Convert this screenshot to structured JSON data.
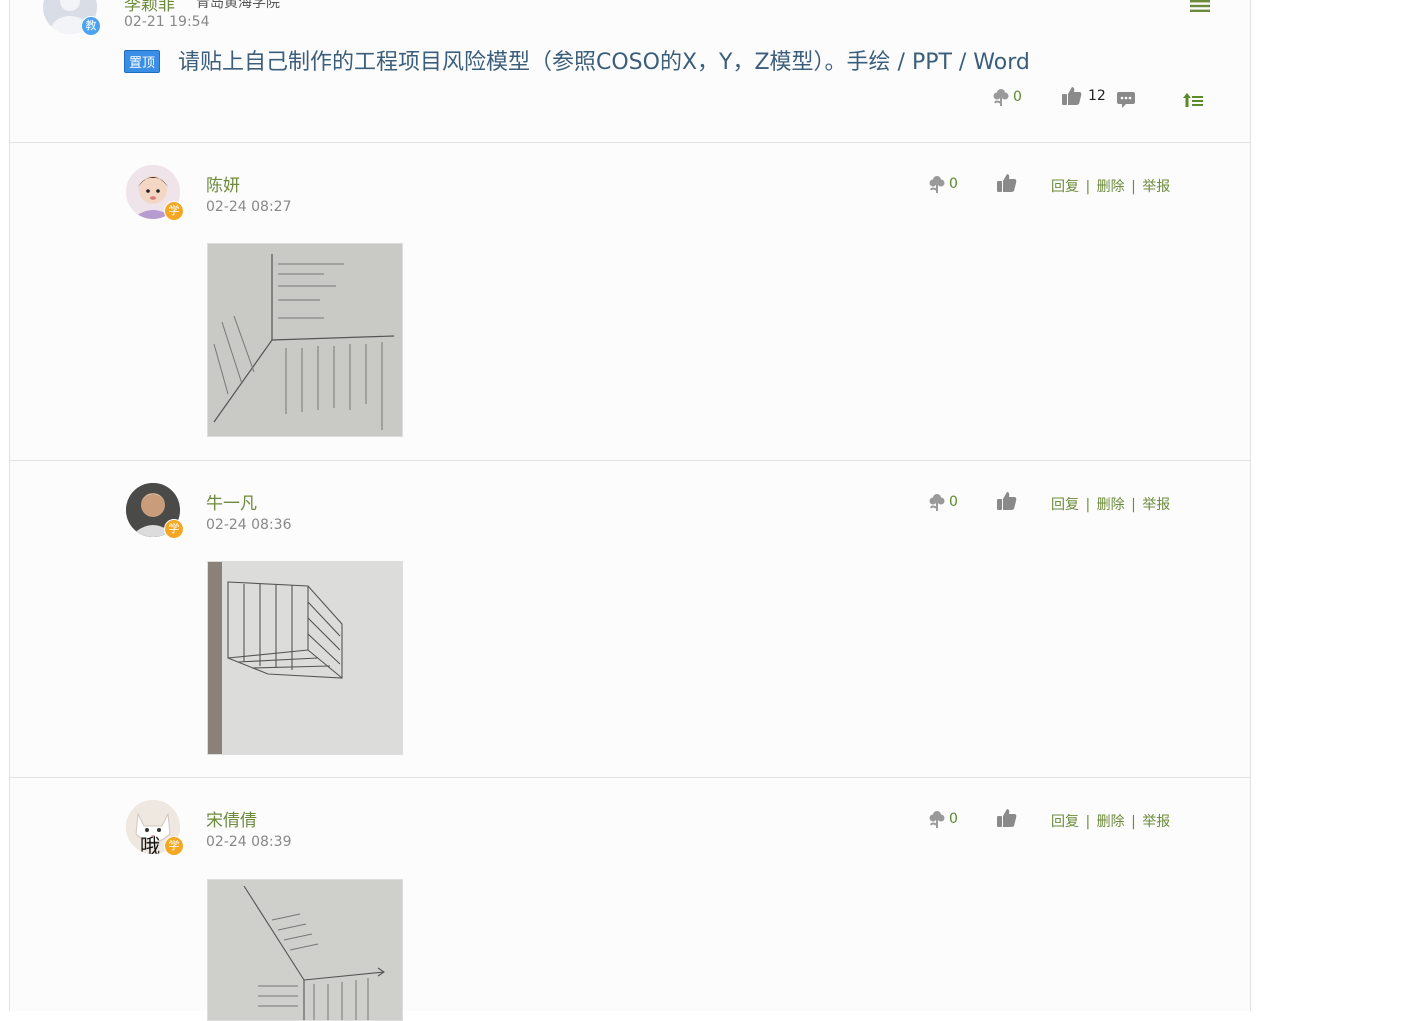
{
  "topic": {
    "author_name": "李颖菲",
    "school": "青岛黄海学院",
    "role_badge": "教",
    "time": "02-21 19:54",
    "pin_label": "置顶",
    "title": "请贴上自己制作的工程项目风险模型（参照COSO的X，Y，Z模型）。手绘 / PPT / Word",
    "flower_count": "0",
    "like_count": "12",
    "menu_icon": "menu-lines-icon"
  },
  "replies": [
    {
      "name": "陈妍",
      "time": "02-24 08:27",
      "role_badge": "学",
      "avatar_overlay": "",
      "flower_count": "0",
      "actions": {
        "reply": "回复",
        "delete": "删除",
        "report": "举报",
        "sep": "|"
      }
    },
    {
      "name": "牛一凡",
      "time": "02-24 08:36",
      "role_badge": "学",
      "avatar_overlay": "",
      "flower_count": "0",
      "actions": {
        "reply": "回复",
        "delete": "删除",
        "report": "举报",
        "sep": "|"
      }
    },
    {
      "name": "宋倩倩",
      "time": "02-24 08:39",
      "role_badge": "学",
      "avatar_overlay": "哦",
      "flower_count": "0",
      "actions": {
        "reply": "回复",
        "delete": "删除",
        "report": "举报",
        "sep": "|"
      }
    }
  ],
  "colors": {
    "accent_green": "#6d8b3c",
    "teacher_badge": "#4aa3f0",
    "student_badge": "#f5a623",
    "pin_blue": "#3a8ee6"
  }
}
